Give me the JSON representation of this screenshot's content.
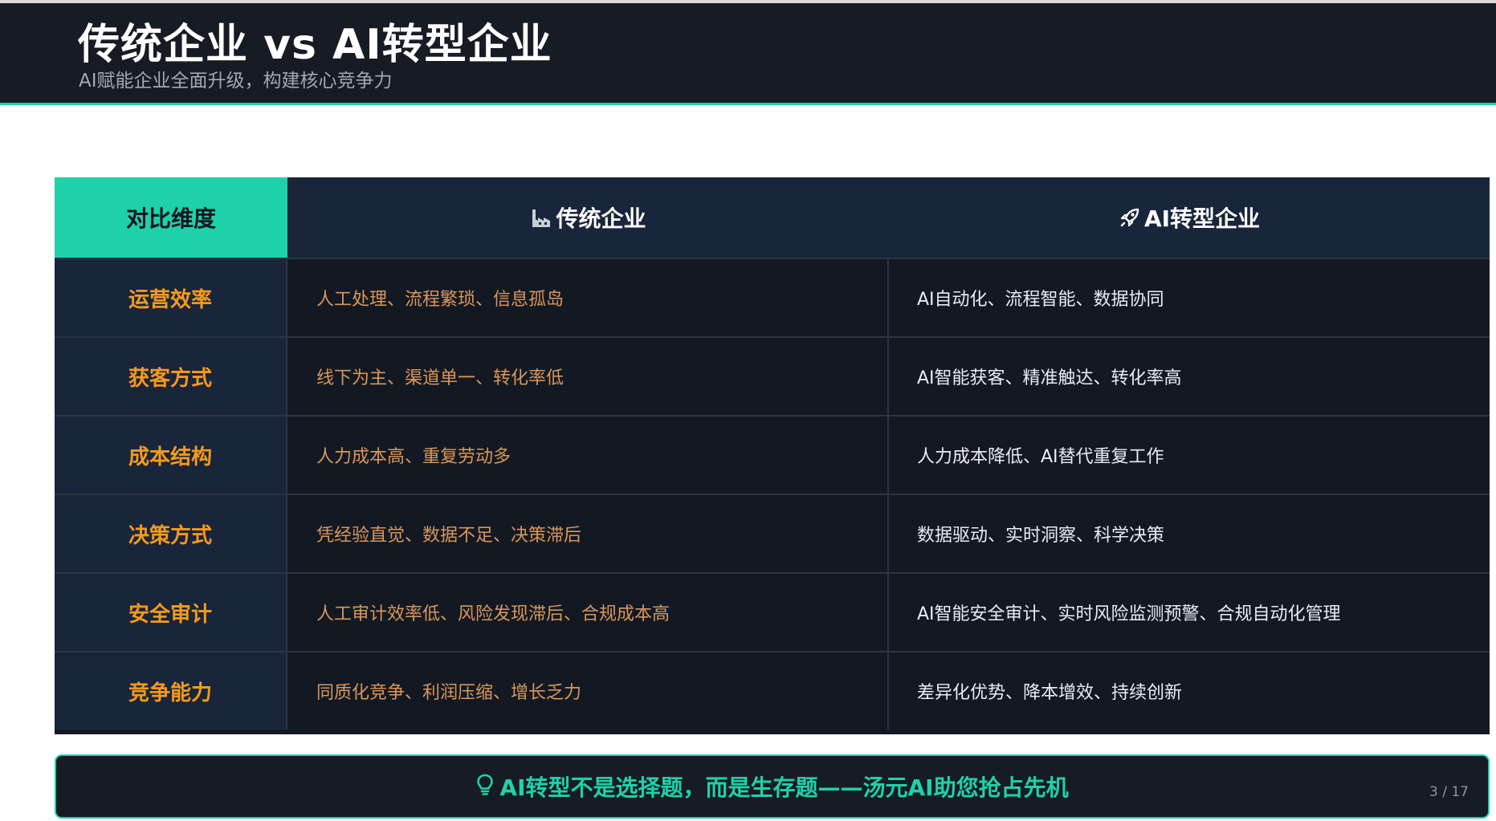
{
  "header": {
    "title": "传统企业 vs AI转型企业",
    "subtitle": "AI赋能企业全面升级，构建核心竞争力"
  },
  "table": {
    "header": {
      "dimension": "对比维度",
      "traditional": "传统企业",
      "traditional_icon": "factory-icon",
      "ai": "AI转型企业",
      "ai_icon": "rocket-icon"
    },
    "rows": [
      {
        "dimension": "运营效率",
        "traditional": "人工处理、流程繁琐、信息孤岛",
        "ai": "AI自动化、流程智能、数据协同"
      },
      {
        "dimension": "获客方式",
        "traditional": "线下为主、渠道单一、转化率低",
        "ai": "AI智能获客、精准触达、转化率高"
      },
      {
        "dimension": "成本结构",
        "traditional": "人力成本高、重复劳动多",
        "ai": "人力成本降低、AI替代重复工作"
      },
      {
        "dimension": "决策方式",
        "traditional": "凭经验直觉、数据不足、决策滞后",
        "ai": "数据驱动、实时洞察、科学决策"
      },
      {
        "dimension": "安全审计",
        "traditional": "人工审计效率低、风险发现滞后、合规成本高",
        "ai": "AI智能安全审计、实时风险监测预警、合规自动化管理"
      },
      {
        "dimension": "竞争能力",
        "traditional": "同质化竞争、利润压缩、增长乏力",
        "ai": "差异化优势、降本增效、持续创新"
      }
    ]
  },
  "banner": {
    "icon": "lightbulb-icon",
    "text": "AI转型不是选择题，而是生存题——汤元AI助您抢占先机"
  },
  "pager": {
    "text": "3 / 17"
  },
  "colors": {
    "accent": "#1fd1a9",
    "header_bg": "#161b24",
    "dimension_text": "#f59a1e",
    "traditional_text": "#d9975a"
  }
}
